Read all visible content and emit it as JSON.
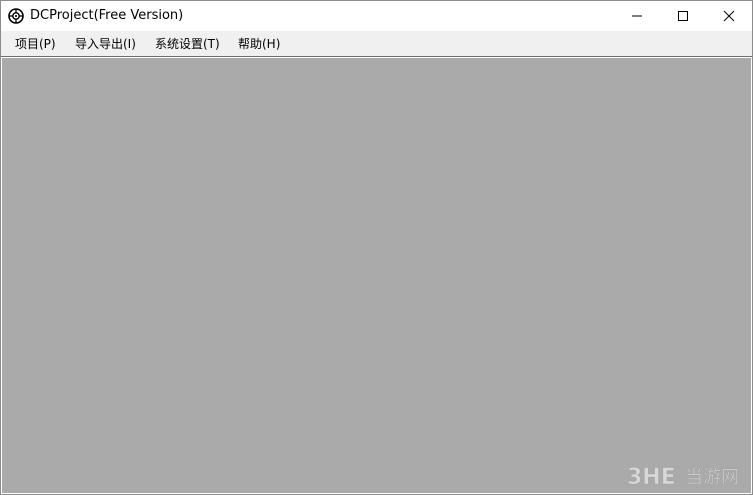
{
  "window": {
    "title": "DCProject(Free Version)",
    "icon": "app-gear-icon"
  },
  "controls": {
    "minimize": "minimize-icon",
    "maximize": "maximize-icon",
    "close": "close-icon"
  },
  "menu": {
    "items": [
      {
        "label": "项目(P)"
      },
      {
        "label": "导入导出(I)"
      },
      {
        "label": "系统设置(T)"
      },
      {
        "label": "帮助(H)"
      }
    ]
  },
  "colors": {
    "client_background": "#aaaaaa",
    "menubar_background": "#f0f0f0"
  }
}
